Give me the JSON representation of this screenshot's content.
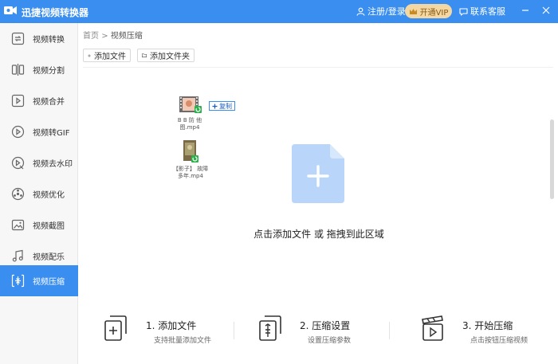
{
  "app": {
    "title": "迅捷视频转换器"
  },
  "topbar": {
    "login_label": "注册/登录",
    "vip_label": "开通VIP",
    "service_label": "联系客服"
  },
  "sidebar": {
    "items": [
      {
        "label": "视频转换",
        "icon": "video-convert-icon"
      },
      {
        "label": "视频分割",
        "icon": "split-icon"
      },
      {
        "label": "视频合并",
        "icon": "merge-icon"
      },
      {
        "label": "视频转GIF",
        "icon": "gif-icon"
      },
      {
        "label": "视频去水印",
        "icon": "watermark-icon"
      },
      {
        "label": "视频优化",
        "icon": "optimize-icon"
      },
      {
        "label": "视频截图",
        "icon": "screenshot-icon"
      },
      {
        "label": "视频配乐",
        "icon": "music-icon"
      },
      {
        "label": "视频压缩",
        "icon": "compress-icon",
        "active": true
      }
    ]
  },
  "breadcrumb": {
    "home": "首页",
    "separator": ">",
    "current": "视频压缩"
  },
  "toolbar": {
    "add_file": "添加文件",
    "add_folder": "添加文件夹"
  },
  "dragged_files": [
    {
      "name_line1": "B B 防 他",
      "name_line2": "图.mp4"
    },
    {
      "name_line1": "【影子】 故障",
      "name_line2": "多年.mp4"
    }
  ],
  "copy_tooltip": "复制",
  "dropzone": {
    "hint": "点击添加文件 或 拖拽到此区域"
  },
  "steps": [
    {
      "title": "1. 添加文件",
      "desc": "支持批量添加文件"
    },
    {
      "title": "2. 压缩设置",
      "desc": "设置压缩参数"
    },
    {
      "title": "3. 开始压缩",
      "desc": "点击按钮压缩视频"
    }
  ],
  "colors": {
    "accent": "#3a8ef0",
    "vip": "#f4d8a4",
    "dropzone_file": "#b9d6fa"
  }
}
